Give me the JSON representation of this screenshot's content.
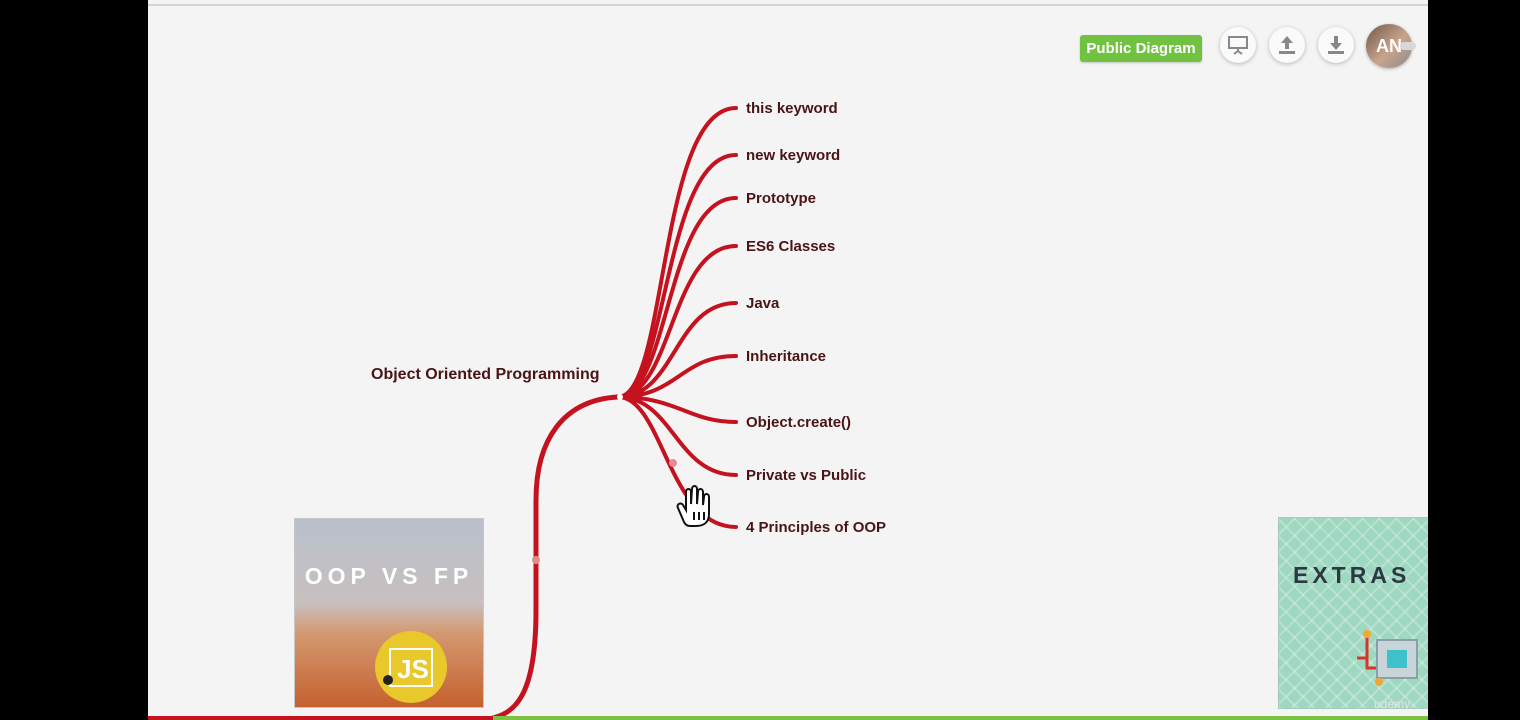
{
  "toolbar": {
    "badge_label": "Public Diagram",
    "icons": [
      "present-icon",
      "share-upload-icon",
      "download-icon"
    ],
    "avatar_initials": "AN"
  },
  "mindmap": {
    "root_label": "Object Oriented Programming",
    "branch_color": "#c4121f",
    "children": [
      "this keyword",
      "new keyword",
      "Prototype",
      "ES6 Classes",
      "Java",
      "Inheritance",
      "Object.create()",
      "Private vs Public",
      "4 Principles of OOP"
    ]
  },
  "thumbnails": {
    "left_title": "OOP VS FP",
    "left_badge": "JS",
    "right_title": "EXTRAS"
  },
  "watermark": "udemy",
  "colors": {
    "accent_green": "#72c242",
    "branch_red": "#c4121f"
  }
}
